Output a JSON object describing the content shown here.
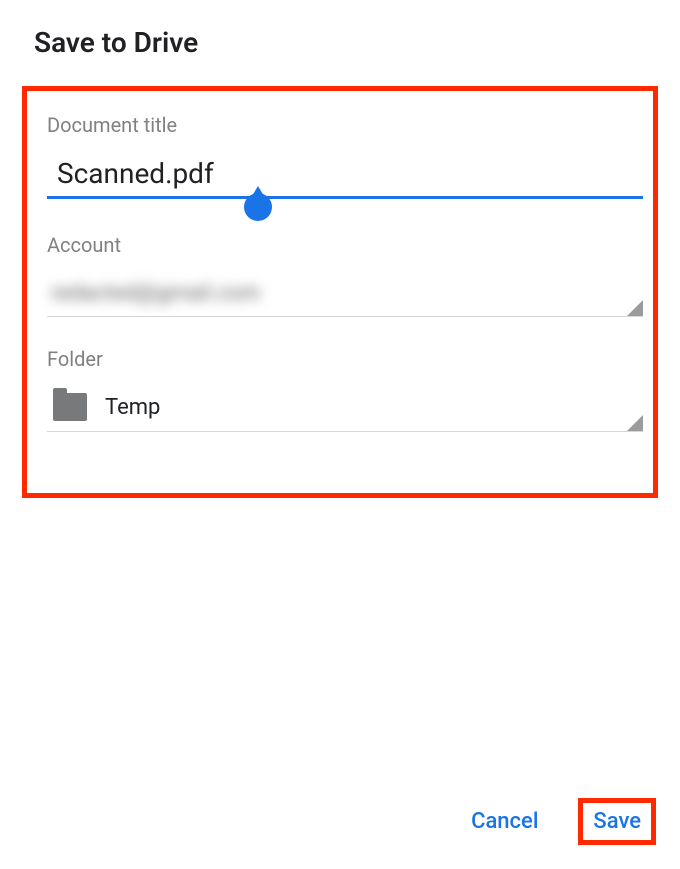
{
  "dialog": {
    "title": "Save to Drive",
    "fields": {
      "document_title_label": "Document title",
      "document_title_value": "Scanned.pdf",
      "account_label": "Account",
      "account_value": "redacted@gmail.com",
      "folder_label": "Folder",
      "folder_value": "Temp"
    },
    "actions": {
      "cancel": "Cancel",
      "save": "Save"
    }
  },
  "colors": {
    "accent": "#1a74e8",
    "highlight": "#ff2a00"
  }
}
